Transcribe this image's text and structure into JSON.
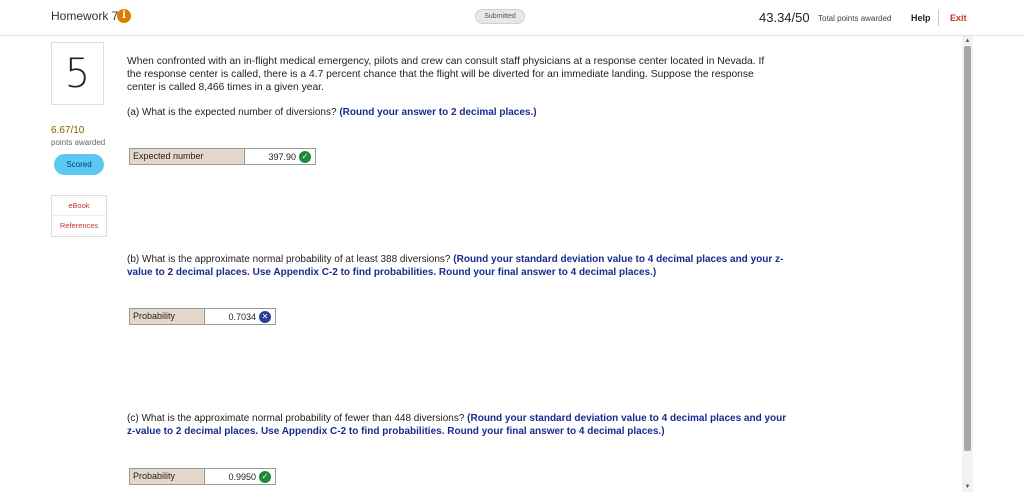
{
  "header": {
    "title": "Homework 7",
    "info_icon": "i",
    "status": "Submitted",
    "score": "43.34/50",
    "score_label": "Total points awarded",
    "help": "Help",
    "exit": "Exit"
  },
  "question": {
    "number": "5",
    "points": "6.67/10",
    "points_label": "points awarded",
    "scored": "Scored",
    "links": [
      "eBook",
      "References"
    ],
    "stem": "When confronted with an in-flight medical emergency, pilots and crew can consult staff physicians at a response center located in Nevada. If the response center is called, there is a 4.7 percent chance that the flight will be diverted for an immediate landing. Suppose the response center is called 8,466 times in a given year."
  },
  "parts": {
    "a": {
      "text": "(a) What is the expected number of diversions? ",
      "instr": "(Round your answer to 2 decimal places.)",
      "answer_label": "Expected number",
      "answer_value": "397.90",
      "status": "correct"
    },
    "b": {
      "text": "(b) What is the approximate normal probability of at least 388 diversions? ",
      "instr": "(Round your standard deviation value to 4 decimal places and your z-value to 2 decimal places. Use Appendix C-2 to find probabilities. Round your final answer to 4 decimal places.)",
      "answer_label": "Probability",
      "answer_value": "0.7034",
      "status": "incorrect"
    },
    "c": {
      "text": "(c) What is the approximate normal probability of fewer than 448 diversions? ",
      "instr": "(Round your standard deviation value to 4 decimal places and your z-value to 2 decimal places. Use Appendix C-2 to find probabilities. Round your final answer to 4 decimal places.)",
      "answer_label": "Probability",
      "answer_value": "0.9950",
      "status": "correct"
    }
  },
  "icons": {
    "check": "✓",
    "x": "✕",
    "scroll_up": "▲",
    "scroll_down": "▼"
  },
  "colors": {
    "accent_blue": "#1a2b8f",
    "correct_green": "#1f8a3b",
    "incorrect_blue": "#2a3d9a",
    "scored_pill": "#5bc8f1",
    "exit_red": "#c0392b"
  }
}
